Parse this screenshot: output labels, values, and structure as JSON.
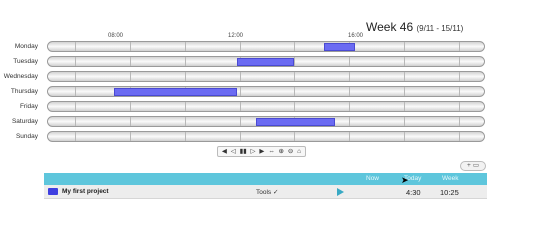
{
  "header": {
    "week": "Week 46",
    "range": "(9/11 - 15/11)"
  },
  "timeline": {
    "time_labels": [
      "08:00",
      "12:00",
      "16:00"
    ],
    "days": [
      {
        "label": "Monday",
        "bars": [
          [
            15.1,
            16.2
          ]
        ]
      },
      {
        "label": "Tuesday",
        "bars": [
          [
            11.9,
            14.0
          ]
        ]
      },
      {
        "label": "Wednesday",
        "bars": []
      },
      {
        "label": "Thursday",
        "bars": [
          [
            7.4,
            11.9
          ]
        ]
      },
      {
        "label": "Friday",
        "bars": []
      },
      {
        "label": "Saturday",
        "bars": [
          [
            12.6,
            15.5
          ]
        ]
      },
      {
        "label": "Sunday",
        "bars": []
      }
    ],
    "bar_color": "#6b6bf2"
  },
  "controls": {
    "first": "◀",
    "prev": "◁",
    "pause": "▮▮",
    "next": "▷",
    "last": "▶",
    "fit": "⇔",
    "zoom_in": "⊕",
    "zoom_out": "⊖",
    "home": "⌂"
  },
  "add_button": {
    "plus": "+",
    "folder": "▭"
  },
  "table": {
    "headers": {
      "now": "Now",
      "today": "Today",
      "week": "Week"
    },
    "rows": [
      {
        "color": "#3f3fe0",
        "name": "My first project",
        "tools": "Tools ✓",
        "today": "4:30",
        "week": "10:25"
      }
    ]
  },
  "colors": {
    "header_bg": "#5ec6dc",
    "play_icon": "#38a9c4"
  }
}
